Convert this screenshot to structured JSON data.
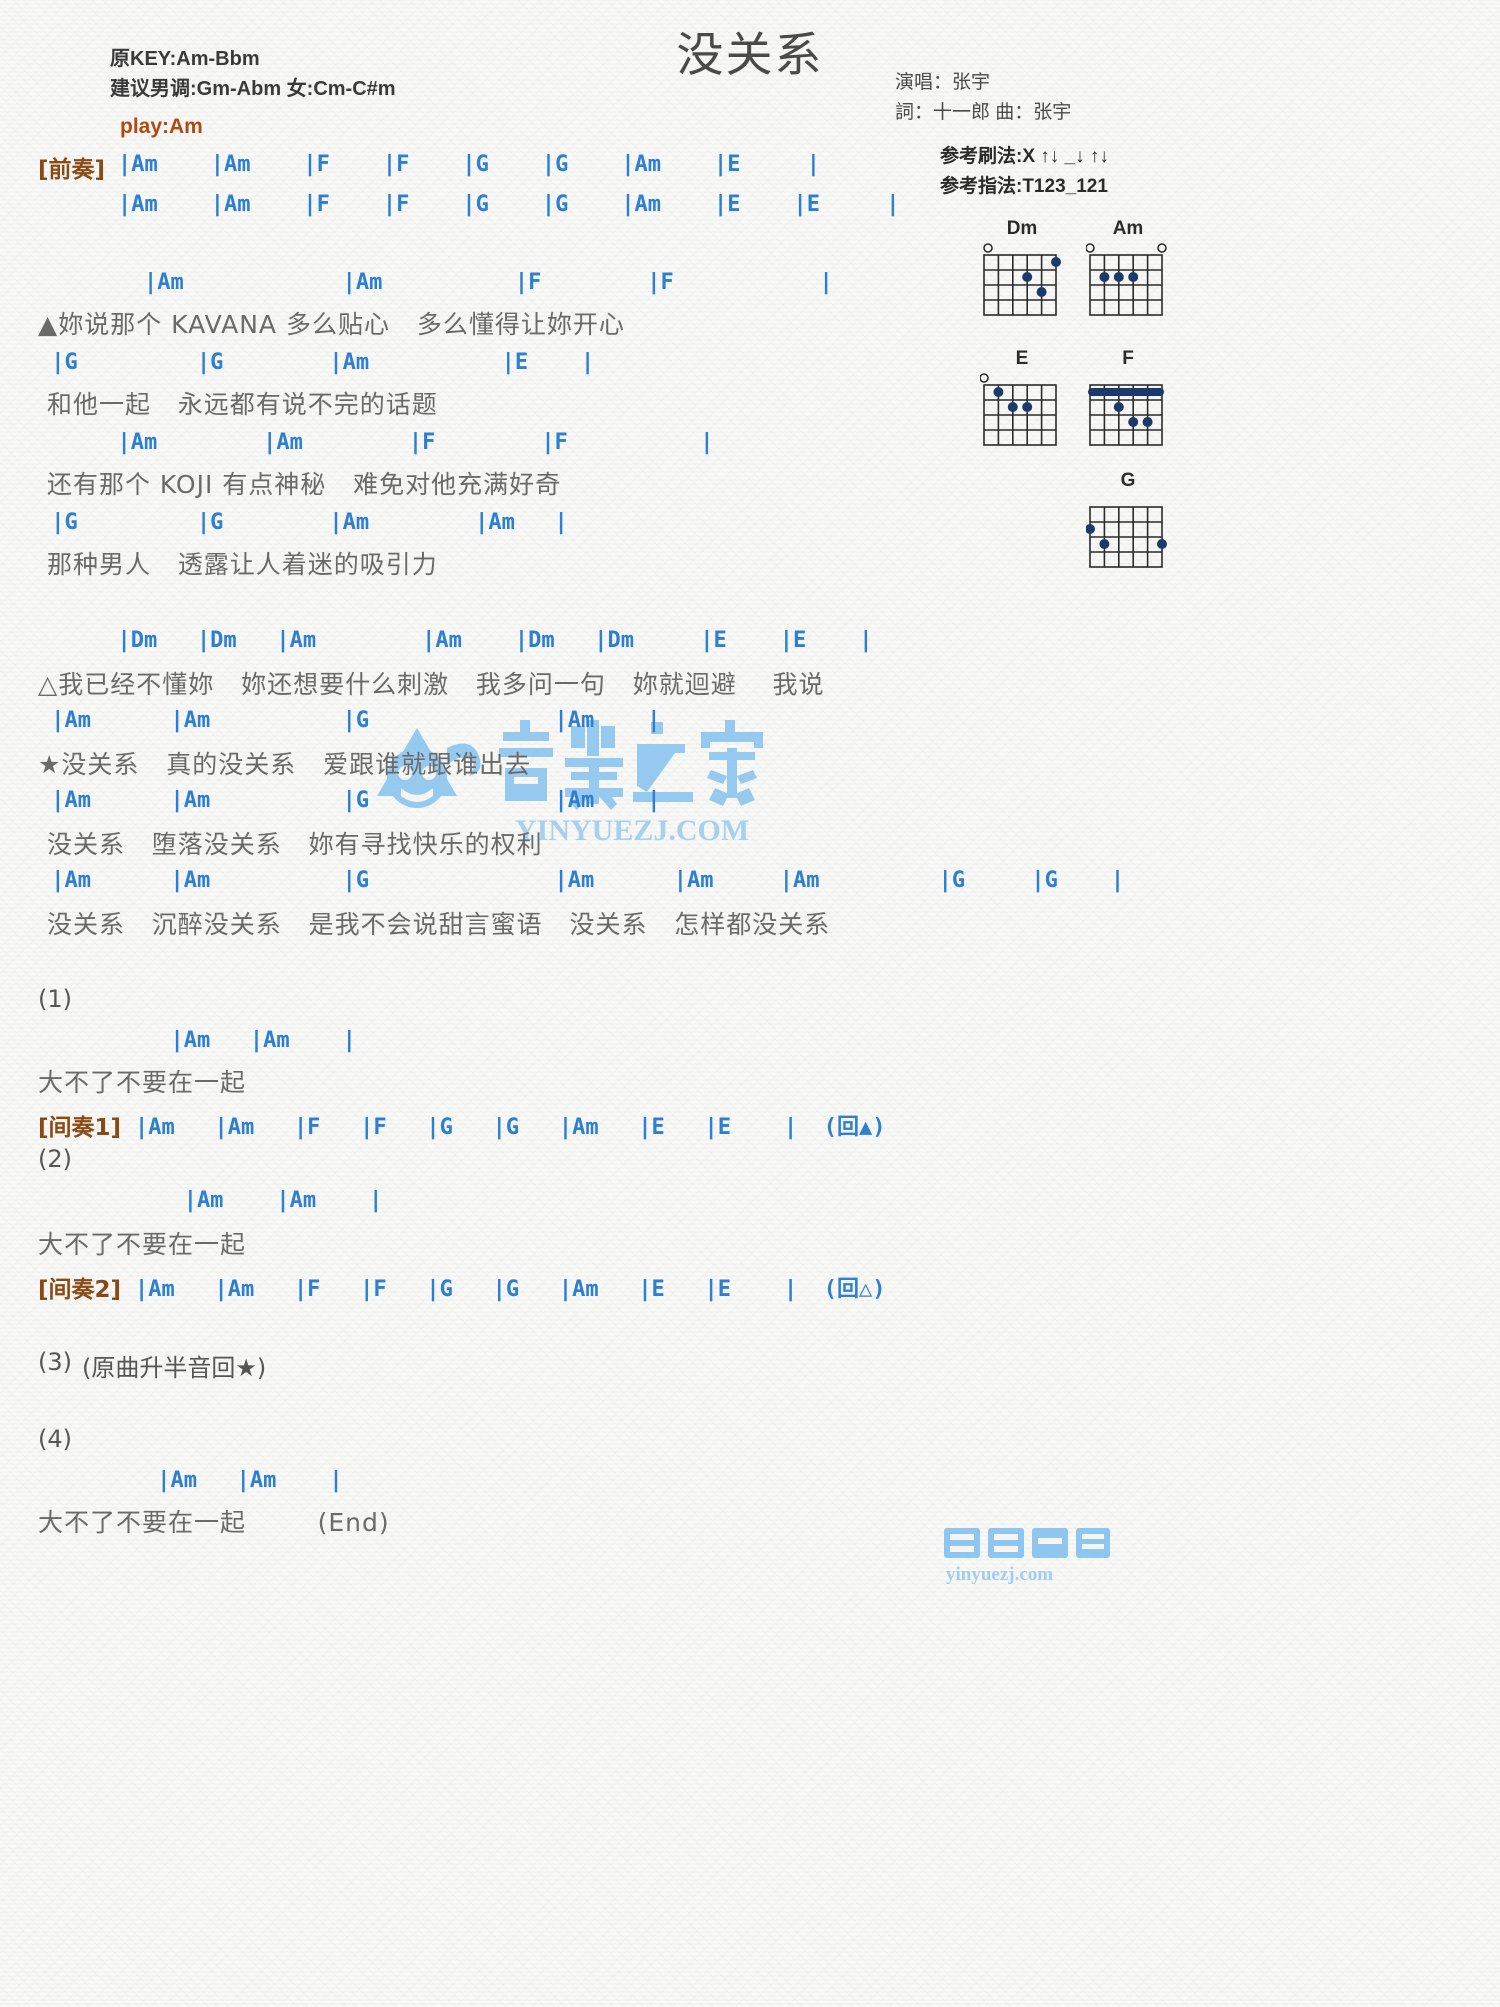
{
  "header": {
    "title": "没关系",
    "orig_key": "原KEY:Am-Bbm",
    "suggest_key": "建议男调:Gm-Abm 女:Cm-C#m",
    "play_key": "play:Am",
    "singer": "演唱：张宇",
    "writer": "詞：十一郎   曲：张宇",
    "strum": "参考刷法:X ↑↓ _↓ ↑↓",
    "fingerstyle": "参考指法:T123_121"
  },
  "intro": {
    "tag": "[前奏]",
    "line1": "|Am    |Am    |F    |F    |G    |G    |Am    |E     |",
    "line2": "|Am    |Am    |F    |F    |G    |G    |Am    |E    |E     |"
  },
  "verse1": [
    {
      "chords": "        |Am            |Am          |F        |F           |",
      "lyric": "▲妳说那个 KAVANA 多么贴心   多么懂得让妳开心"
    },
    {
      "chords": " |G         |G        |Am          |E    |",
      "lyric": " 和他一起   永远都有说不完的话题"
    },
    {
      "chords": "      |Am        |Am        |F        |F          |",
      "lyric": " 还有那个 KOJI 有点神秘   难免对他充满好奇"
    },
    {
      "chords": " |G         |G        |Am        |Am   |",
      "lyric": " 那种男人   透露让人着迷的吸引力"
    }
  ],
  "bridge": [
    {
      "chords": "      |Dm   |Dm   |Am        |Am    |Dm   |Dm     |E    |E    |",
      "lyric": "△我已经不懂妳   妳还想要什么刺激   我多问一句   妳就迴避    我说"
    }
  ],
  "chorus": [
    {
      "chords": " |Am      |Am          |G              |Am    |",
      "lyric": "★没关系   真的没关系   爱跟谁就跟谁出去"
    },
    {
      "chords": " |Am      |Am          |G              |Am    |",
      "lyric": " 没关系   堕落没关系   妳有寻找快乐的权利"
    },
    {
      "chords": " |Am      |Am          |G              |Am      |Am     |Am         |G     |G    |",
      "lyric": " 没关系   沉醉没关系   是我不会说甜言蜜语   没关系   怎样都没关系"
    }
  ],
  "endings": [
    {
      "num": "(1)",
      "chords": "          |Am   |Am    |",
      "lyric": "大不了不要在一起",
      "interlude_tag": "[间奏1]",
      "interlude": "|Am   |Am   |F   |F   |G   |G   |Am   |E   |E    |  (回▲)"
    },
    {
      "num": "(2)",
      "chords": "           |Am    |Am    |",
      "lyric": "大不了不要在一起",
      "interlude_tag": "[间奏2]",
      "interlude": "|Am   |Am   |F   |F   |G   |G   |Am   |E   |E    |  (回△)"
    },
    {
      "num": "(3)",
      "note": "(原曲升半音回★)"
    },
    {
      "num": "(4)",
      "chords": "         |Am   |Am    |",
      "lyric": "大不了不要在一起        (End)"
    }
  ],
  "chord_diagrams": [
    {
      "name": "Dm",
      "open_strings": [
        3
      ],
      "muted_strings": [
        0,
        1
      ],
      "dots": [
        {
          "string": 3,
          "fret": 2
        },
        {
          "string": 4,
          "fret": 3
        },
        {
          "string": 5,
          "fret": 1
        }
      ],
      "barre": null
    },
    {
      "name": "Am",
      "open_strings": [
        0,
        5
      ],
      "muted_strings": [],
      "dots": [
        {
          "string": 2,
          "fret": 2
        },
        {
          "string": 3,
          "fret": 2
        },
        {
          "string": 4,
          "fret": 1
        }
      ],
      "barre": null
    },
    {
      "name": "E",
      "open_strings": [
        0,
        4,
        5
      ],
      "muted_strings": [],
      "dots": [
        {
          "string": 1,
          "fret": 2
        },
        {
          "string": 2,
          "fret": 2
        },
        {
          "string": 3,
          "fret": 1
        }
      ],
      "barre": null
    },
    {
      "name": "F",
      "open_strings": [],
      "muted_strings": [],
      "dots": [
        {
          "string": 2,
          "fret": 2
        },
        {
          "string": 3,
          "fret": 3
        },
        {
          "string": 4,
          "fret": 3
        }
      ],
      "barre": 1
    },
    {
      "name": "G",
      "open_strings": [],
      "muted_strings": [],
      "dots": [
        {
          "string": 0,
          "fret": 3
        },
        {
          "string": 1,
          "fret": 2
        },
        {
          "string": 5,
          "fret": 3
        }
      ],
      "barre": null
    }
  ],
  "watermark": {
    "text_cn": "音樂之家",
    "text_url": "YINYUEZJ.COM",
    "footer_cn": "音乐之家",
    "footer_url": "yinyuezj.com",
    "color": "#8ec6ef"
  }
}
